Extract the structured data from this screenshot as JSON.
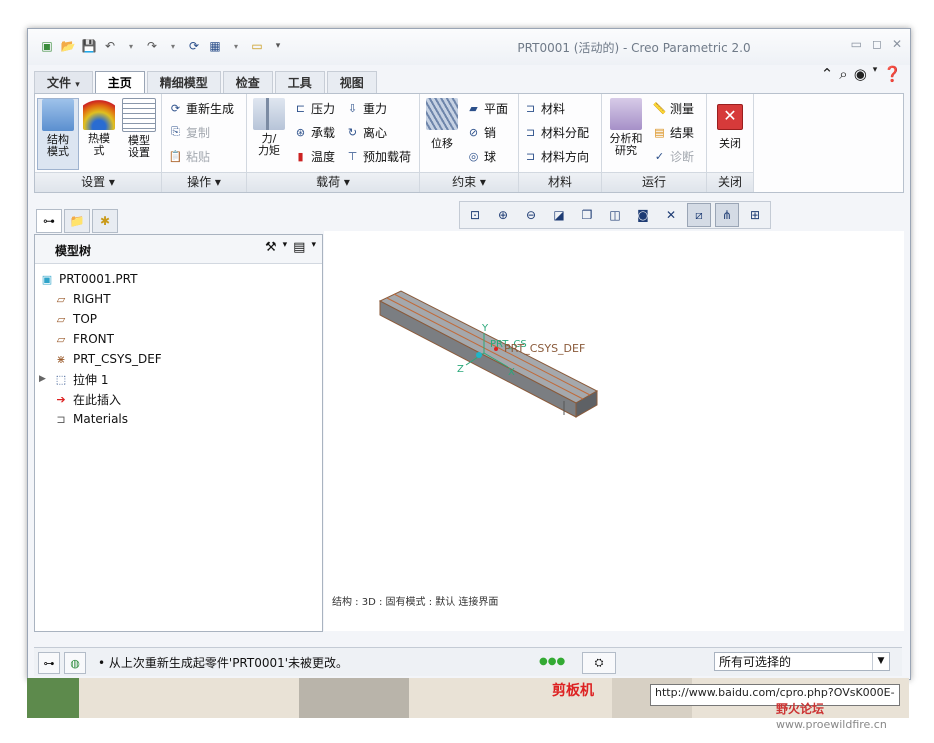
{
  "window": {
    "title": "PRT0001 (活动的) - Creo Parametric 2.0",
    "controls": [
      "minimize-icon",
      "restore-icon",
      "close-icon"
    ]
  },
  "quick_access": [
    "new-icon",
    "open-icon",
    "save-icon",
    "undo-icon",
    "redo-icon",
    "regenerate-icon",
    "windows-icon",
    "close-window-icon",
    "customize-icon"
  ],
  "tabs": [
    {
      "label": "文件",
      "arrow": "▾"
    },
    {
      "label": "主页"
    },
    {
      "label": "精细模型"
    },
    {
      "label": "检查"
    },
    {
      "label": "工具"
    },
    {
      "label": "视图"
    }
  ],
  "ribbon": {
    "setup": {
      "label": "设置 ▾",
      "structure_mode": "结构\n模式",
      "thermal_mode": "热模\n式",
      "model_setup": "模型\n设置"
    },
    "operations": {
      "label": "操作 ▾",
      "regenerate": "重新生成",
      "copy": "复制",
      "paste": "粘贴"
    },
    "loads": {
      "label": "载荷 ▾",
      "force": "力/\n力矩",
      "pressure": "压力",
      "bearing": "承载",
      "temperature": "温度",
      "gravity": "重力",
      "centrifugal": "离心",
      "preload": "预加载荷"
    },
    "constraints": {
      "label": "约束 ▾",
      "displacement": "位移",
      "plane": "平面",
      "pin": "销",
      "ball": "球"
    },
    "material": {
      "label": "材料",
      "materials": "材料",
      "assignment": "材料分配",
      "orientation": "材料方向"
    },
    "run": {
      "label": "运行",
      "analysis": "分析和\n研究",
      "measure": "测量",
      "results": "结果",
      "diagnostics": "诊断"
    },
    "close": {
      "label": "关闭",
      "close": "关闭"
    }
  },
  "view_toolbar": [
    "refit-icon",
    "zoom-in-icon",
    "zoom-out-icon",
    "reorient-icon",
    "saved-views-icon",
    "display-style-icon",
    "spin-center-icon",
    "datum-display-icon",
    "planes-display-icon",
    "axes-display-icon",
    "csys-display-icon",
    "simulation-display-icon"
  ],
  "left_panel": {
    "tabs": [
      "model-tree-icon",
      "folder-icon",
      "favorites-icon"
    ],
    "title": "模型树",
    "items": [
      {
        "label": "PRT0001.PRT",
        "icon": "part-icon",
        "indent": 0
      },
      {
        "label": "RIGHT",
        "icon": "datum-plane-icon",
        "indent": 1
      },
      {
        "label": "TOP",
        "icon": "datum-plane-icon",
        "indent": 1
      },
      {
        "label": "FRONT",
        "icon": "datum-plane-icon",
        "indent": 1
      },
      {
        "label": "PRT_CSYS_DEF",
        "icon": "csys-icon",
        "indent": 1
      },
      {
        "label": "拉伸 1",
        "icon": "extrude-icon",
        "indent": 1,
        "expand": "▶"
      },
      {
        "label": "在此插入",
        "icon": "insert-arrow-icon",
        "indent": 1
      },
      {
        "label": "Materials",
        "icon": "materials-icon",
        "indent": 1
      }
    ]
  },
  "viewport": {
    "csys_label": "PRT_CSYS_DEF",
    "csys_short": "PRT_CS",
    "axis_y": "Y",
    "axis_z": "Z",
    "axis_x": "X",
    "status": "结构 : 3D : 固有模式 : 默认 连接界面"
  },
  "statusbar": {
    "message": "• 从上次重新生成起零件'PRT0001'未被更改。",
    "filter": "所有可选择的"
  },
  "overlay": {
    "url": "http://www.baidu.com/cpro.php?OVsK000E-",
    "red_text": "剪板机",
    "site": "野火论坛",
    "site_url": "www.proewildfire.cn"
  }
}
